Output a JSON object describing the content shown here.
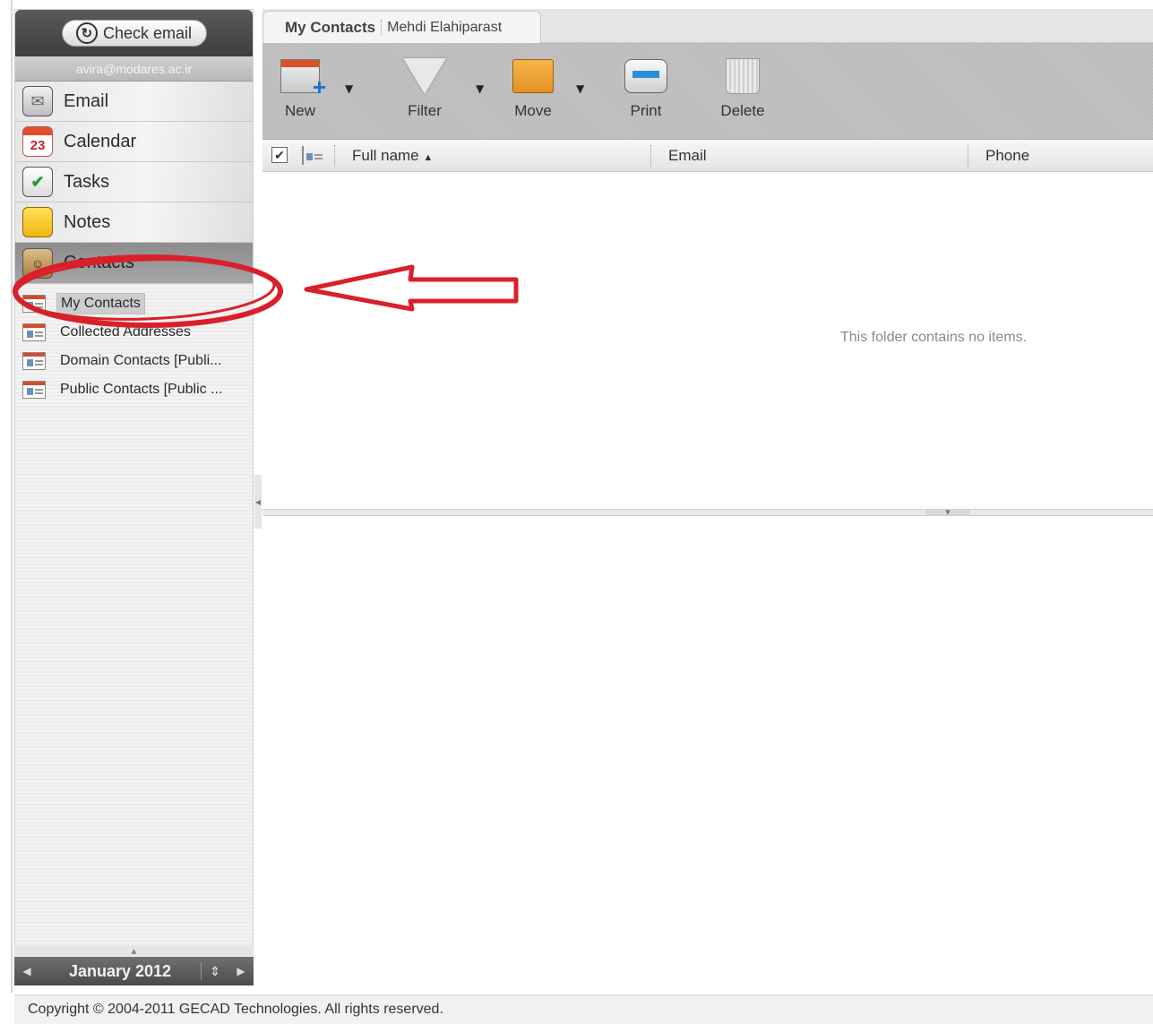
{
  "sidebar": {
    "check_email_label": "Check email",
    "account": "avira@modares.ac.ir",
    "modules": [
      {
        "label": "Email",
        "icon": "email-icon"
      },
      {
        "label": "Calendar",
        "icon": "calendar-icon",
        "icon_text": "23"
      },
      {
        "label": "Tasks",
        "icon": "tasks-icon"
      },
      {
        "label": "Notes",
        "icon": "notes-icon"
      },
      {
        "label": "Contacts",
        "icon": "contacts-icon"
      }
    ],
    "folders": [
      {
        "label": "My Contacts",
        "selected": true
      },
      {
        "label": "Collected Addresses"
      },
      {
        "label": "Domain Contacts [Publi..."
      },
      {
        "label": "Public Contacts [Public ..."
      }
    ],
    "mini_calendar": {
      "label": "January 2012"
    }
  },
  "main": {
    "tab": {
      "name": "My Contacts",
      "owner": "Mehdi Elahiparast"
    },
    "toolbar": {
      "new_label": "New",
      "filter_label": "Filter",
      "move_label": "Move",
      "print_label": "Print",
      "delete_label": "Delete"
    },
    "columns": {
      "full_name": "Full name",
      "email": "Email",
      "phone": "Phone"
    },
    "sort_indicator": "▲",
    "empty_message": "This folder contains no items."
  },
  "footer": {
    "copyright": "Copyright © 2004-2011 GECAD Technologies. All rights reserved."
  },
  "colors": {
    "annotation_red": "#d9202a",
    "accent_gray": "#4a4a4a"
  }
}
